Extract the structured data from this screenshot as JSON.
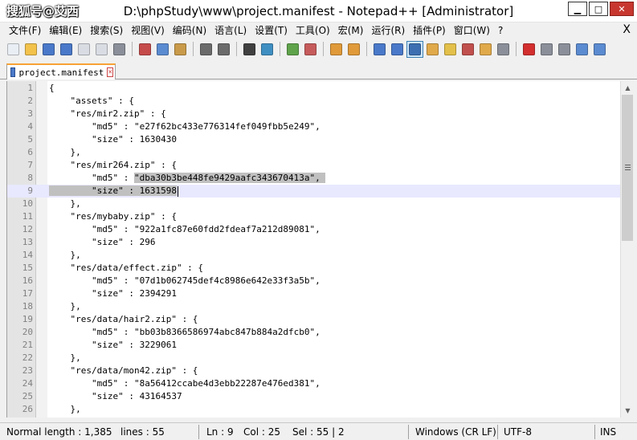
{
  "window": {
    "watermark": "搜狐号@艾西",
    "title": "D:\\phpStudy\\www\\project.manifest - Notepad++ [Administrator]",
    "minimize": "▁",
    "restore": "□",
    "close": "✕"
  },
  "menu": {
    "items": [
      "文件(F)",
      "编辑(E)",
      "搜索(S)",
      "视图(V)",
      "编码(N)",
      "语言(L)",
      "设置(T)",
      "工具(O)",
      "宏(M)",
      "运行(R)",
      "插件(P)",
      "窗口(W)",
      "?"
    ],
    "close_doc": "X"
  },
  "toolbar": {
    "buttons": [
      {
        "name": "new-file-icon",
        "color": "#e9eef5"
      },
      {
        "name": "open-file-icon",
        "color": "#f2c24b"
      },
      {
        "name": "save-icon",
        "color": "#4a79c9"
      },
      {
        "name": "save-all-icon",
        "color": "#4a79c9"
      },
      {
        "name": "close-icon",
        "color": "#d9dde3"
      },
      {
        "name": "close-all-icon",
        "color": "#d9dde3"
      },
      {
        "name": "print-icon",
        "color": "#8a8f99"
      },
      {
        "sep": true
      },
      {
        "name": "cut-icon",
        "color": "#c64b4b"
      },
      {
        "name": "copy-icon",
        "color": "#5b8bd0"
      },
      {
        "name": "paste-icon",
        "color": "#c89a4a"
      },
      {
        "sep": true
      },
      {
        "name": "undo-icon",
        "color": "#6b6b6b"
      },
      {
        "name": "redo-icon",
        "color": "#6b6b6b"
      },
      {
        "sep": true
      },
      {
        "name": "find-icon",
        "color": "#404040"
      },
      {
        "name": "replace-icon",
        "color": "#3f8fc2"
      },
      {
        "sep": true
      },
      {
        "name": "zoom-in-icon",
        "color": "#5fa34b"
      },
      {
        "name": "zoom-out-icon",
        "color": "#c65b5b"
      },
      {
        "sep": true
      },
      {
        "name": "sync-vertical-icon",
        "color": "#e09a3a"
      },
      {
        "name": "sync-horizontal-icon",
        "color": "#e09a3a"
      },
      {
        "sep": true
      },
      {
        "name": "word-wrap-icon",
        "color": "#4a79c9"
      },
      {
        "name": "show-all-chars-icon",
        "color": "#4a79c9"
      },
      {
        "name": "indent-guide-icon",
        "color": "#3c6fb1",
        "active": true
      },
      {
        "name": "udl-icon",
        "color": "#e0a94a"
      },
      {
        "name": "doc-map-icon",
        "color": "#e3c04a"
      },
      {
        "name": "function-list-icon",
        "color": "#c0504d"
      },
      {
        "name": "folder-workspace-icon",
        "color": "#e0a94a"
      },
      {
        "name": "monitoring-icon",
        "color": "#8a8f99"
      },
      {
        "sep": true
      },
      {
        "name": "record-macro-icon",
        "color": "#d32f2f"
      },
      {
        "name": "stop-macro-icon",
        "color": "#8a8f99"
      },
      {
        "name": "play-macro-icon",
        "color": "#8a8f99"
      },
      {
        "name": "run-macro-multiple-icon",
        "color": "#5b8bd0"
      },
      {
        "name": "save-macro-icon",
        "color": "#5b8bd0"
      }
    ]
  },
  "tab": {
    "label": "project.manifest",
    "close": "✕"
  },
  "editor": {
    "lines": [
      {
        "n": "1",
        "t": "{"
      },
      {
        "n": "2",
        "t": "    \"assets\" : {"
      },
      {
        "n": "3",
        "t": "    \"res/mir2.zip\" : {"
      },
      {
        "n": "4",
        "t": "        \"md5\" : \"e27f62bc433e776314fef049fbb5e249\","
      },
      {
        "n": "5",
        "t": "        \"size\" : 1630430"
      },
      {
        "n": "6",
        "t": "    },"
      },
      {
        "n": "7",
        "t": "    \"res/mir264.zip\" : {"
      },
      {
        "n": "8",
        "pre": "        \"md5\" : ",
        "sel": "\"dba30b3be448fe9429aafc343670413a\", "
      },
      {
        "n": "9",
        "sel": "        \"size\" : 1631598",
        "caret": true
      },
      {
        "n": "10",
        "t": "    },"
      },
      {
        "n": "11",
        "t": "    \"res/mybaby.zip\" : {"
      },
      {
        "n": "12",
        "t": "        \"md5\" : \"922a1fc87e60fdd2fdeaf7a212d89081\","
      },
      {
        "n": "13",
        "t": "        \"size\" : 296"
      },
      {
        "n": "14",
        "t": "    },"
      },
      {
        "n": "15",
        "t": "    \"res/data/effect.zip\" : {"
      },
      {
        "n": "16",
        "t": "        \"md5\" : \"07d1b062745def4c8986e642e33f3a5b\","
      },
      {
        "n": "17",
        "t": "        \"size\" : 2394291"
      },
      {
        "n": "18",
        "t": "    },"
      },
      {
        "n": "19",
        "t": "    \"res/data/hair2.zip\" : {"
      },
      {
        "n": "20",
        "t": "        \"md5\" : \"bb03b8366586974abc847b884a2dfcb0\","
      },
      {
        "n": "21",
        "t": "        \"size\" : 3229061"
      },
      {
        "n": "22",
        "t": "    },"
      },
      {
        "n": "23",
        "t": "    \"res/data/mon42.zip\" : {"
      },
      {
        "n": "24",
        "t": "        \"md5\" : \"8a56412ccabe4d3ebb22287e476ed381\","
      },
      {
        "n": "25",
        "t": "        \"size\" : 43164537"
      },
      {
        "n": "26",
        "t": "    },"
      }
    ]
  },
  "scrollbar": {
    "up": "▲",
    "down": "▼"
  },
  "status": {
    "length": "Normal length : 1,385",
    "lines": "lines : 55",
    "ln": "Ln : 9",
    "col": "Col : 25",
    "sel": "Sel : 55 | 2",
    "eol": "Windows (CR LF)",
    "encoding": "UTF-8",
    "mode": "INS"
  }
}
